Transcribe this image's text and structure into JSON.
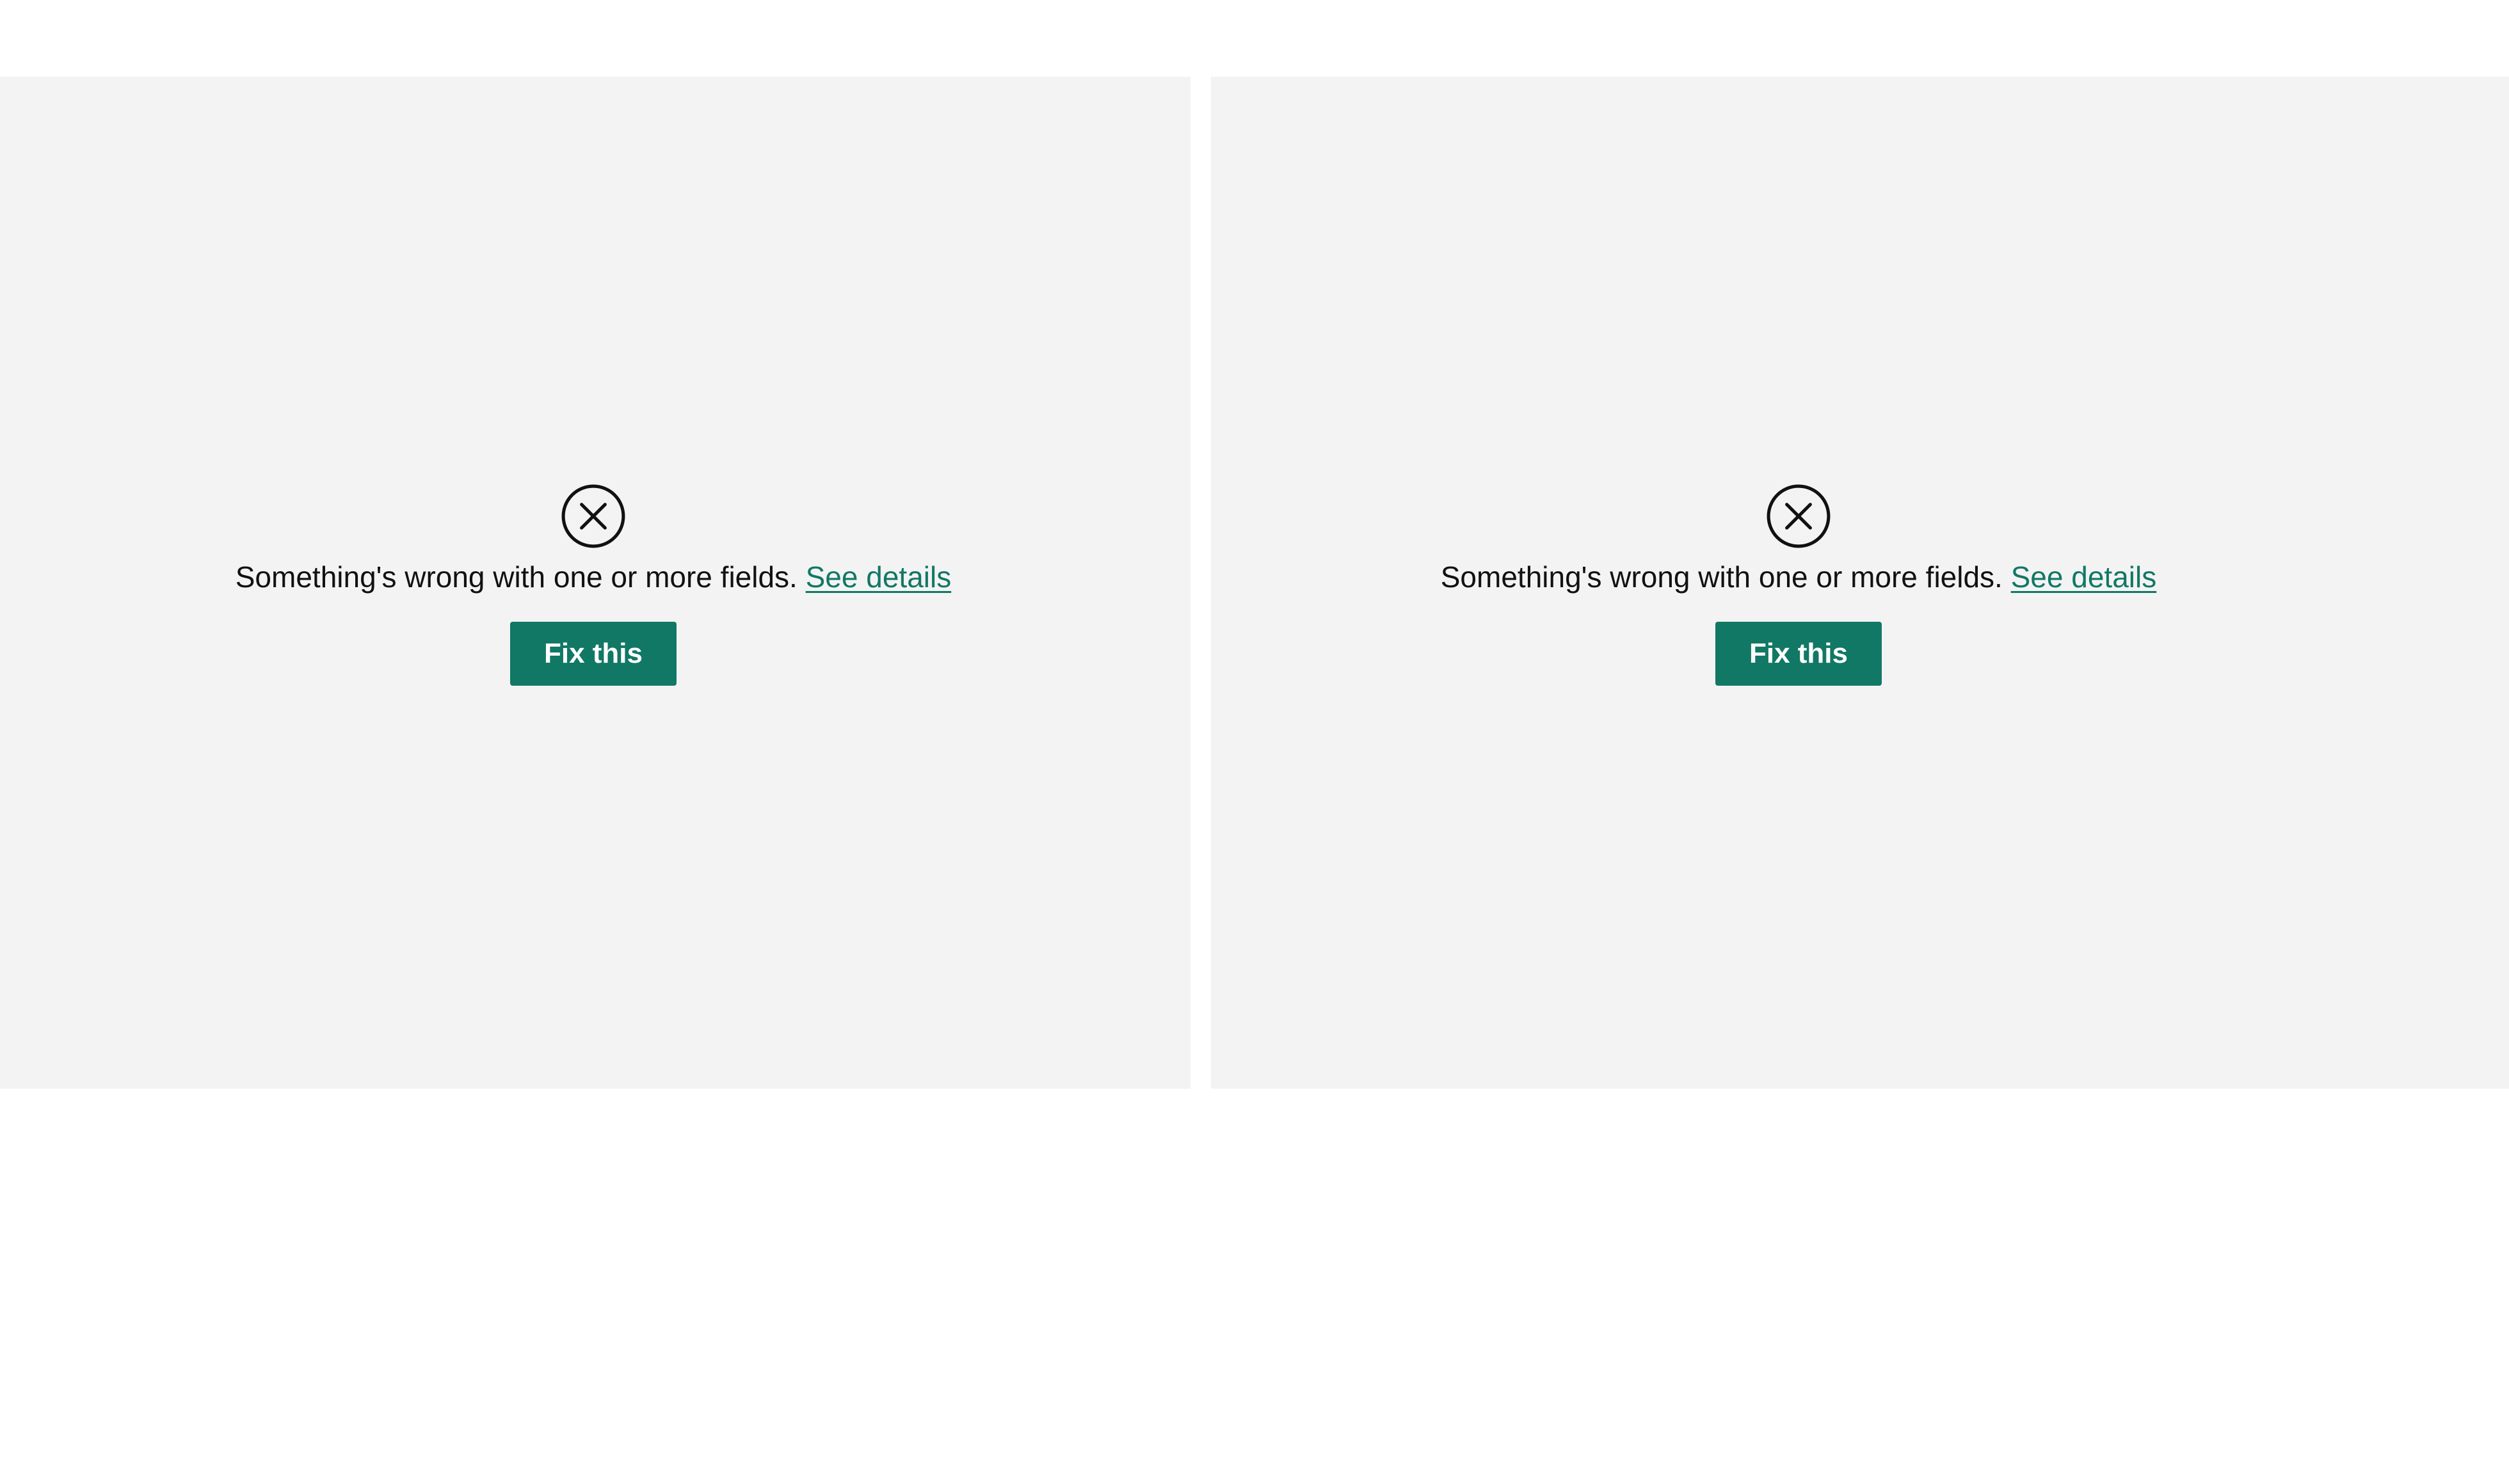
{
  "panels": [
    {
      "error_icon": "error-circle-x-icon",
      "message": "Something's wrong with one or more fields.",
      "link_label": "See details",
      "button_label": "Fix this"
    },
    {
      "error_icon": "error-circle-x-icon",
      "message": "Something's wrong with one or more fields.",
      "link_label": "See details",
      "button_label": "Fix this"
    }
  ],
  "colors": {
    "panel_background": "#f3f3f3",
    "accent": "#117865",
    "text": "#111111"
  }
}
